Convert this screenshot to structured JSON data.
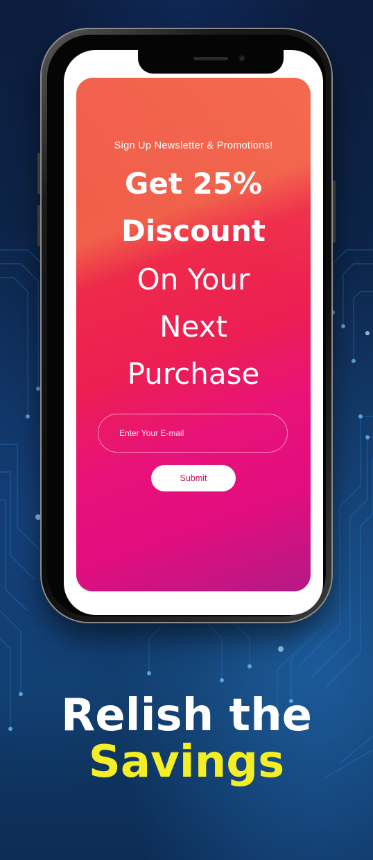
{
  "promo": {
    "subtitle": "Sign Up Newsletter & Promotions!",
    "headline": {
      "line1": "Get 25%",
      "line2": "Discount",
      "line3": "On Your",
      "line4": "Next",
      "line5": "Purchase"
    },
    "email_placeholder": "Enter Your E-mail",
    "submit_label": "Submit"
  },
  "tagline": {
    "line1": "Relish the",
    "line2": "Savings"
  },
  "colors": {
    "accent_yellow": "#f3ee25",
    "submit_text": "#c40f57",
    "background_dark": "#0a1a35"
  }
}
